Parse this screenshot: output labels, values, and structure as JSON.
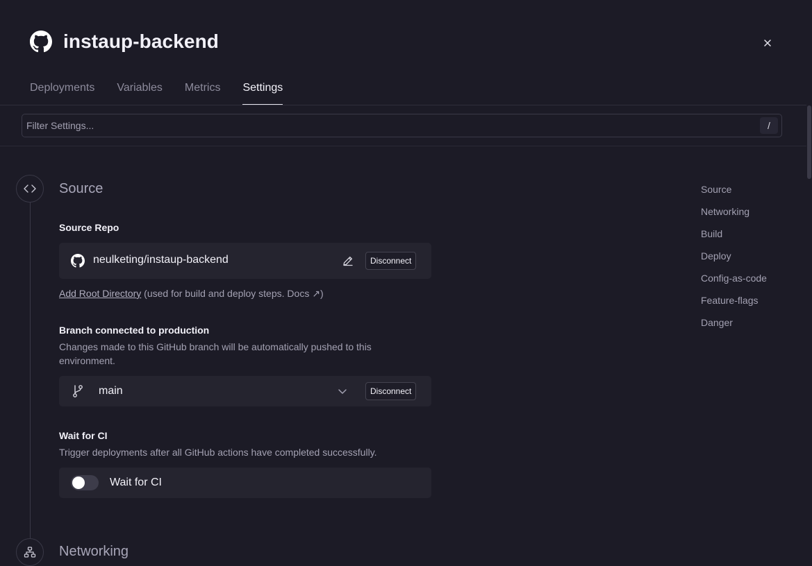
{
  "header": {
    "title": "instaup-backend",
    "tabs": [
      {
        "label": "Deployments",
        "active": false
      },
      {
        "label": "Variables",
        "active": false
      },
      {
        "label": "Metrics",
        "active": false
      },
      {
        "label": "Settings",
        "active": true
      }
    ]
  },
  "filter": {
    "placeholder": "Filter Settings...",
    "shortcut": "/"
  },
  "source_section": {
    "heading": "Source",
    "source_repo": {
      "label": "Source Repo",
      "repo": "neulketing/instaup-backend",
      "disconnect_label": "Disconnect"
    },
    "root_directory": {
      "link": "Add Root Directory",
      "note": "(used for build and deploy steps.",
      "docs": "Docs ↗)"
    },
    "branch": {
      "label": "Branch connected to production",
      "description": "Changes made to this GitHub branch will be automatically pushed to this environment.",
      "value": "main",
      "disconnect_label": "Disconnect"
    },
    "wait_for_ci": {
      "label": "Wait for CI",
      "description": "Trigger deployments after all GitHub actions have completed successfully.",
      "toggle_label": "Wait for CI",
      "enabled": false
    }
  },
  "networking_section": {
    "heading": "Networking"
  },
  "right_nav": {
    "items": [
      "Source",
      "Networking",
      "Build",
      "Deploy",
      "Config-as-code",
      "Feature-flags",
      "Danger"
    ]
  },
  "colors": {
    "background": "#1c1b26",
    "card": "#25242f",
    "text_primary": "#f2f1f8",
    "text_muted": "#a3a1b2",
    "border": "#3a3947"
  }
}
